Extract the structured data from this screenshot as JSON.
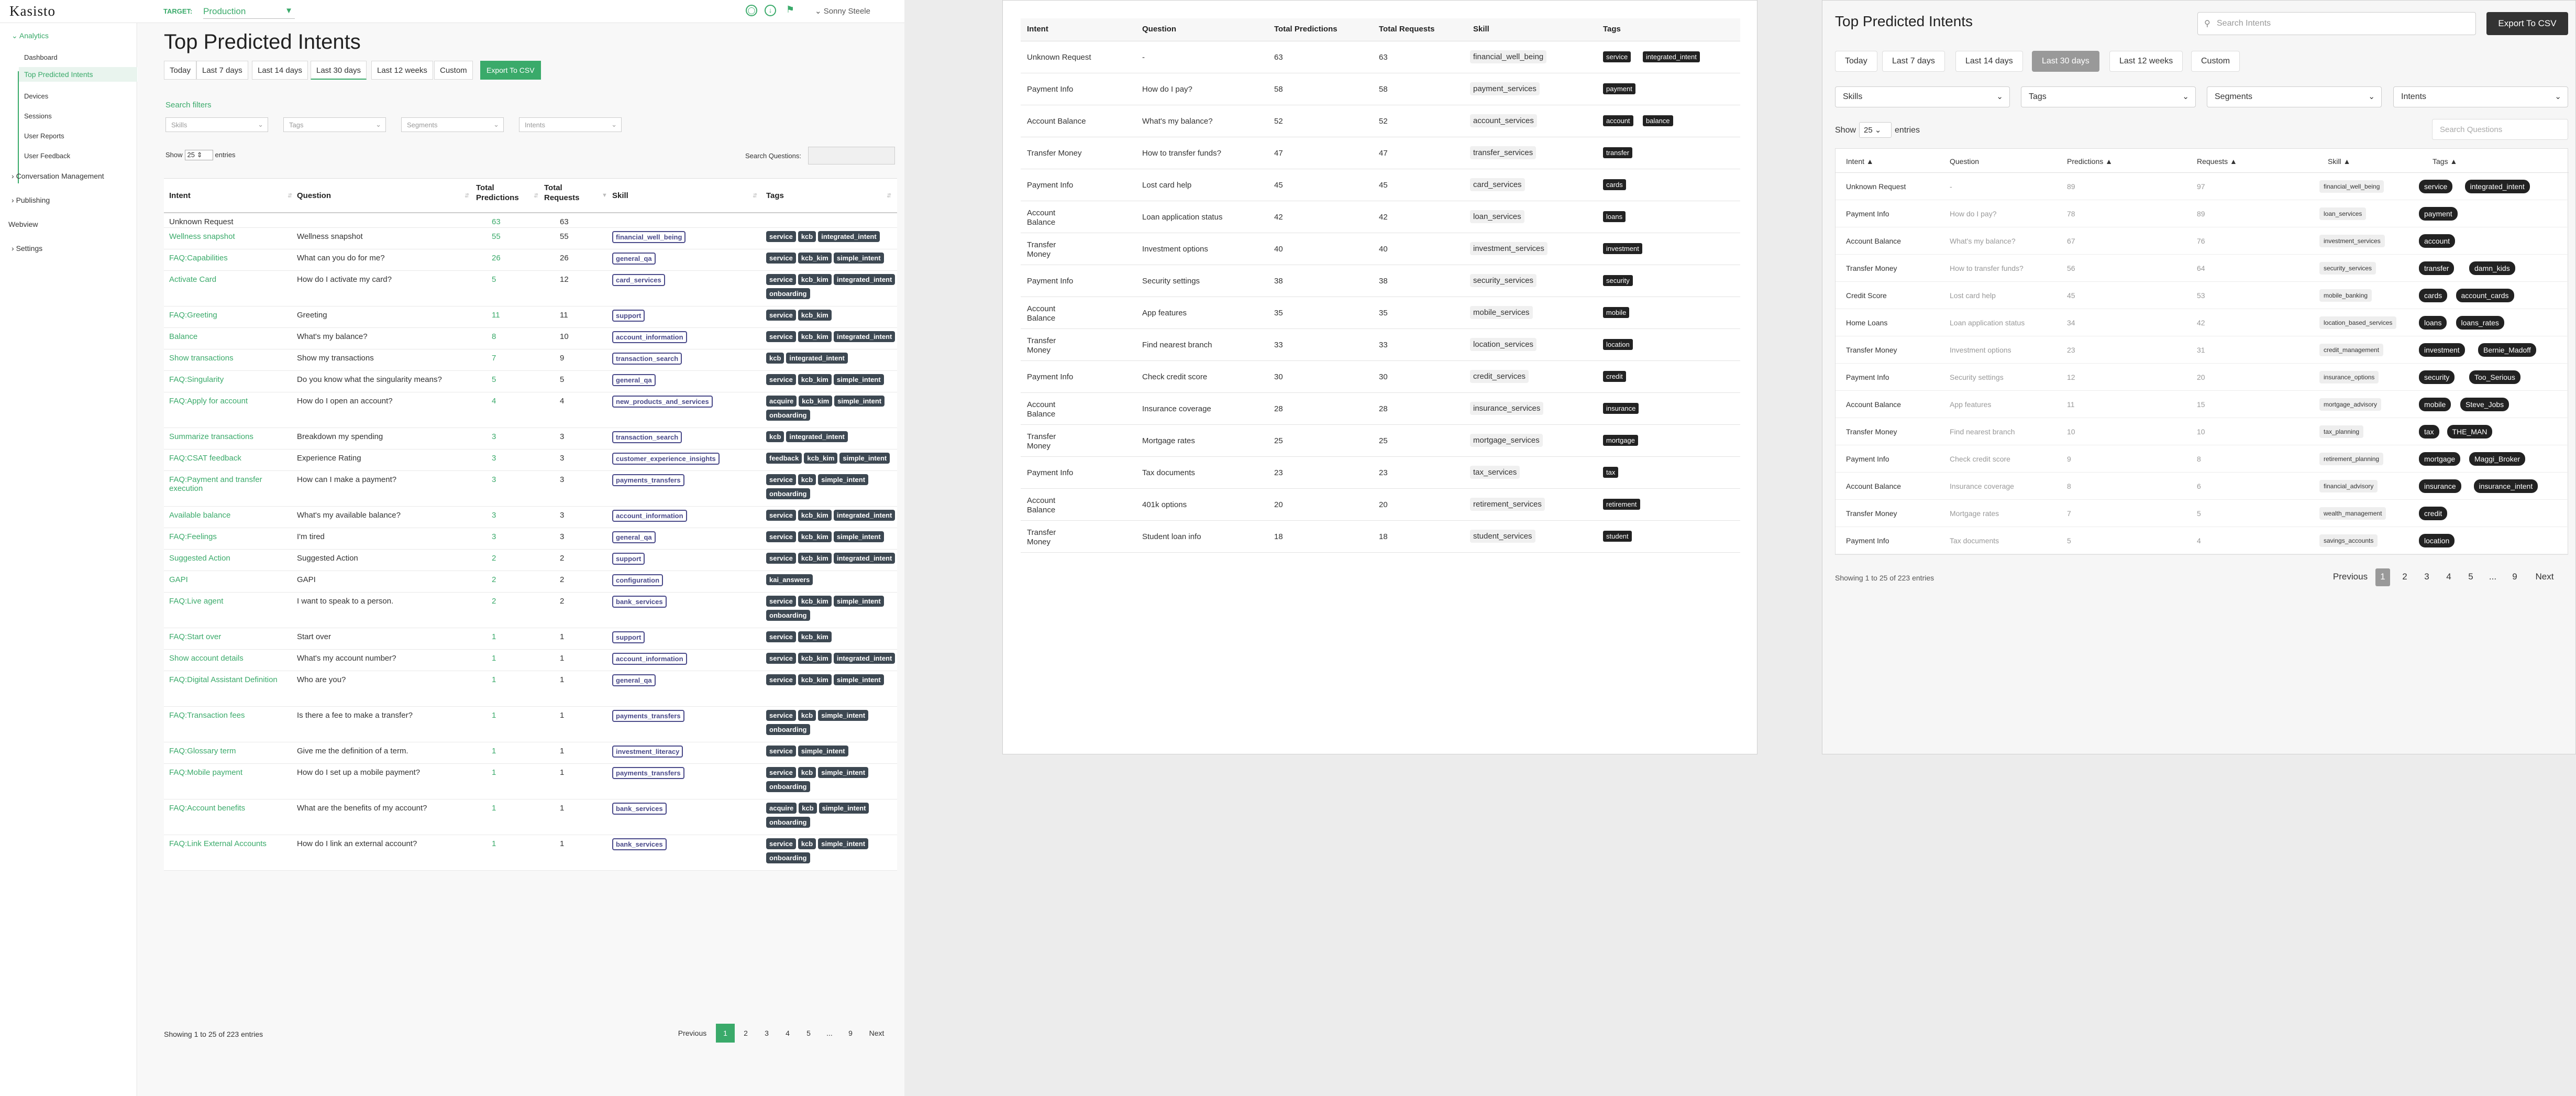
{
  "panelA": {
    "logo": "Kasisto",
    "target_label": "TARGET:",
    "environment": "Production",
    "user": "Sonny Steele",
    "nav": {
      "analytics": "Analytics",
      "items": [
        "Dashboard",
        "Top Predicted Intents",
        "Devices",
        "Sessions",
        "User Reports",
        "User Feedback"
      ],
      "conversation": "Conversation Management",
      "publishing": "Publishing",
      "webview": "Webview",
      "settings": "Settings"
    },
    "title": "Top Predicted Intents",
    "date_buttons": [
      "Today",
      "Last 7 days",
      "Last 14 days",
      "Last 30 days",
      "Last 12 weeks",
      "Custom"
    ],
    "export": "Export To CSV",
    "search_filters": "Search filters",
    "filters": [
      "Skills",
      "Tags",
      "Segments",
      "Intents"
    ],
    "show": "Show",
    "page_size": "25",
    "entries": "entries",
    "search_questions": "Search Questions:",
    "headers": {
      "intent": "Intent",
      "question": "Question",
      "predictions": "Total Predictions",
      "requests": "Total Requests",
      "skill": "Skill",
      "tags": "Tags"
    },
    "rows": [
      {
        "intent": "Unknown Request",
        "question": "",
        "pred": "63",
        "req": "63",
        "skill": "",
        "tags": []
      },
      {
        "intent": "Wellness snapshot",
        "question": "Wellness snapshot",
        "pred": "55",
        "req": "55",
        "skill": "financial_well_being",
        "tags": [
          "service",
          "kcb",
          "integrated_intent"
        ]
      },
      {
        "intent": "FAQ:Capabilities",
        "question": "What can you do for me?",
        "pred": "26",
        "req": "26",
        "skill": "general_qa",
        "tags": [
          "service",
          "kcb_kim",
          "simple_intent"
        ]
      },
      {
        "intent": "Activate Card",
        "question": "How do I activate my card?",
        "pred": "5",
        "req": "12",
        "skill": "card_services",
        "tags": [
          "service",
          "kcb_kim",
          "integrated_intent",
          "onboarding"
        ]
      },
      {
        "intent": "FAQ:Greeting",
        "question": "Greeting",
        "pred": "11",
        "req": "11",
        "skill": "support",
        "tags": [
          "service",
          "kcb_kim"
        ]
      },
      {
        "intent": "Balance",
        "question": "What's my balance?",
        "pred": "8",
        "req": "10",
        "skill": "account_information",
        "tags": [
          "service",
          "kcb_kim",
          "integrated_intent"
        ]
      },
      {
        "intent": "Show transactions",
        "question": "Show my transactions",
        "pred": "7",
        "req": "9",
        "skill": "transaction_search",
        "tags": [
          "kcb",
          "integrated_intent"
        ]
      },
      {
        "intent": "FAQ:Singularity",
        "question": "Do you know what the singularity means?",
        "pred": "5",
        "req": "5",
        "skill": "general_qa",
        "tags": [
          "service",
          "kcb_kim",
          "simple_intent"
        ]
      },
      {
        "intent": "FAQ:Apply for account",
        "question": "How do I open an account?",
        "pred": "4",
        "req": "4",
        "skill": "new_products_and_services",
        "tags": [
          "acquire",
          "kcb_kim",
          "simple_intent",
          "onboarding"
        ]
      },
      {
        "intent": "Summarize transactions",
        "question": "Breakdown my spending",
        "pred": "3",
        "req": "3",
        "skill": "transaction_search",
        "tags": [
          "kcb",
          "integrated_intent"
        ]
      },
      {
        "intent": "FAQ:CSAT feedback",
        "question": "Experience Rating",
        "pred": "3",
        "req": "3",
        "skill": "customer_experience_insights",
        "tags": [
          "feedback",
          "kcb_kim",
          "simple_intent"
        ]
      },
      {
        "intent": "FAQ:Payment and transfer execution",
        "question": "How can I make a payment?",
        "pred": "3",
        "req": "3",
        "skill": "payments_transfers",
        "tags": [
          "service",
          "kcb",
          "simple_intent",
          "onboarding"
        ]
      },
      {
        "intent": "Available balance",
        "question": "What's my available balance?",
        "pred": "3",
        "req": "3",
        "skill": "account_information",
        "tags": [
          "service",
          "kcb_kim",
          "integrated_intent"
        ]
      },
      {
        "intent": "FAQ:Feelings",
        "question": "I'm tired",
        "pred": "3",
        "req": "3",
        "skill": "general_qa",
        "tags": [
          "service",
          "kcb_kim",
          "simple_intent"
        ]
      },
      {
        "intent": "Suggested Action",
        "question": "Suggested Action",
        "pred": "2",
        "req": "2",
        "skill": "support",
        "tags": [
          "service",
          "kcb_kim",
          "integrated_intent"
        ]
      },
      {
        "intent": "GAPI",
        "question": "GAPI",
        "pred": "2",
        "req": "2",
        "skill": "configuration",
        "tags": [
          "kai_answers"
        ]
      },
      {
        "intent": "FAQ:Live agent",
        "question": "I want to speak to a person.",
        "pred": "2",
        "req": "2",
        "skill": "bank_services",
        "tags": [
          "service",
          "kcb_kim",
          "simple_intent",
          "onboarding"
        ]
      },
      {
        "intent": "FAQ:Start over",
        "question": "Start over",
        "pred": "1",
        "req": "1",
        "skill": "support",
        "tags": [
          "service",
          "kcb_kim"
        ]
      },
      {
        "intent": "Show account details",
        "question": "What's my account number?",
        "pred": "1",
        "req": "1",
        "skill": "account_information",
        "tags": [
          "service",
          "kcb_kim",
          "integrated_intent"
        ]
      },
      {
        "intent": "FAQ:Digital Assistant Definition",
        "question": "Who are you?",
        "pred": "1",
        "req": "1",
        "skill": "general_qa",
        "tags": [
          "service",
          "kcb_kim",
          "simple_intent"
        ]
      },
      {
        "intent": "FAQ:Transaction fees",
        "question": "Is there a fee to make a transfer?",
        "pred": "1",
        "req": "1",
        "skill": "payments_transfers",
        "tags": [
          "service",
          "kcb",
          "simple_intent",
          "onboarding"
        ]
      },
      {
        "intent": "FAQ:Glossary term",
        "question": "Give me the definition of a term.",
        "pred": "1",
        "req": "1",
        "skill": "investment_literacy",
        "tags": [
          "service",
          "simple_intent"
        ]
      },
      {
        "intent": "FAQ:Mobile payment",
        "question": "How do I set up a mobile payment?",
        "pred": "1",
        "req": "1",
        "skill": "payments_transfers",
        "tags": [
          "service",
          "kcb",
          "simple_intent",
          "onboarding"
        ]
      },
      {
        "intent": "FAQ:Account benefits",
        "question": "What are the benefits of my account?",
        "pred": "1",
        "req": "1",
        "skill": "bank_services",
        "tags": [
          "acquire",
          "kcb",
          "simple_intent",
          "onboarding"
        ]
      },
      {
        "intent": "FAQ:Link External Accounts",
        "question": "How do I link an external account?",
        "pred": "1",
        "req": "1",
        "skill": "bank_services",
        "tags": [
          "service",
          "kcb",
          "simple_intent",
          "onboarding"
        ]
      }
    ],
    "footer": "Showing 1 to 25 of 223 entries",
    "pager": [
      "Previous",
      "1",
      "2",
      "3",
      "4",
      "5",
      "...",
      "9",
      "Next"
    ]
  },
  "panelB": {
    "headers": {
      "intent": "Intent",
      "question": "Question",
      "predictions": "Total Predictions",
      "requests": "Total Requests",
      "skill": "Skill",
      "tags": "Tags"
    },
    "rows": [
      {
        "intent": "Unknown Request",
        "question": "-",
        "pred": "63",
        "req": "63",
        "skill": "financial_well_being",
        "tags": [
          "service",
          "integrated_intent"
        ]
      },
      {
        "intent": "Payment Info",
        "question": "How do I pay?",
        "pred": "58",
        "req": "58",
        "skill": "payment_services",
        "tags": [
          "payment"
        ]
      },
      {
        "intent": "Account Balance",
        "question": "What's my balance?",
        "pred": "52",
        "req": "52",
        "skill": "account_services",
        "tags": [
          "account",
          "balance"
        ]
      },
      {
        "intent": "Transfer Money",
        "question": "How to transfer funds?",
        "pred": "47",
        "req": "47",
        "skill": "transfer_services",
        "tags": [
          "transfer"
        ]
      },
      {
        "intent": "Payment Info",
        "question": "Lost card help",
        "pred": "45",
        "req": "45",
        "skill": "card_services",
        "tags": [
          "cards"
        ]
      },
      {
        "intent": "Account Balance",
        "question": "Loan application status",
        "pred": "42",
        "req": "42",
        "skill": "loan_services",
        "tags": [
          "loans"
        ]
      },
      {
        "intent": "Transfer Money",
        "question": "Investment options",
        "pred": "40",
        "req": "40",
        "skill": "investment_services",
        "tags": [
          "investment"
        ]
      },
      {
        "intent": "Payment Info",
        "question": "Security settings",
        "pred": "38",
        "req": "38",
        "skill": "security_services",
        "tags": [
          "security"
        ]
      },
      {
        "intent": "Account Balance",
        "question": "App features",
        "pred": "35",
        "req": "35",
        "skill": "mobile_services",
        "tags": [
          "mobile"
        ]
      },
      {
        "intent": "Transfer Money",
        "question": "Find nearest branch",
        "pred": "33",
        "req": "33",
        "skill": "location_services",
        "tags": [
          "location"
        ]
      },
      {
        "intent": "Payment Info",
        "question": "Check credit score",
        "pred": "30",
        "req": "30",
        "skill": "credit_services",
        "tags": [
          "credit"
        ]
      },
      {
        "intent": "Account Balance",
        "question": "Insurance coverage",
        "pred": "28",
        "req": "28",
        "skill": "insurance_services",
        "tags": [
          "insurance"
        ]
      },
      {
        "intent": "Transfer Money",
        "question": "Mortgage rates",
        "pred": "25",
        "req": "25",
        "skill": "mortgage_services",
        "tags": [
          "mortgage"
        ]
      },
      {
        "intent": "Payment Info",
        "question": "Tax documents",
        "pred": "23",
        "req": "23",
        "skill": "tax_services",
        "tags": [
          "tax"
        ]
      },
      {
        "intent": "Account Balance",
        "question": "401k options",
        "pred": "20",
        "req": "20",
        "skill": "retirement_services",
        "tags": [
          "retirement"
        ]
      },
      {
        "intent": "Transfer Money",
        "question": "Student loan info",
        "pred": "18",
        "req": "18",
        "skill": "student_services",
        "tags": [
          "student"
        ]
      }
    ]
  },
  "panelC": {
    "title": "Top Predicted Intents",
    "search_placeholder": "Search Intents",
    "export": "Export To CSV",
    "date_buttons": [
      "Today",
      "Last 7 days",
      "Last 14 days",
      "Last 30 days",
      "Last 12 weeks",
      "Custom"
    ],
    "filters": [
      "Skills",
      "Tags",
      "Segments",
      "Intents"
    ],
    "show": "Show",
    "page_size": "25",
    "entries": "entries",
    "search_questions": "Search Questions",
    "headers": {
      "intent": "Intent",
      "question": "Question",
      "predictions": "Predictions",
      "requests": "Requests",
      "skill": "Skill",
      "tags": "Tags"
    },
    "rows": [
      {
        "intent": "Unknown Request",
        "question": "-",
        "pred": "89",
        "req": "97",
        "skill": "financial_well_being",
        "tags": [
          "service",
          "integrated_intent"
        ]
      },
      {
        "intent": "Payment Info",
        "question": "How do I pay?",
        "pred": "78",
        "req": "89",
        "skill": "loan_services",
        "tags": [
          "payment"
        ]
      },
      {
        "intent": "Account Balance",
        "question": "What's my balance?",
        "pred": "67",
        "req": "76",
        "skill": "investment_services",
        "tags": [
          "account"
        ]
      },
      {
        "intent": "Transfer Money",
        "question": "How to transfer funds?",
        "pred": "56",
        "req": "64",
        "skill": "security_services",
        "tags": [
          "transfer",
          "damn_kids"
        ]
      },
      {
        "intent": "Credit Score",
        "question": "Lost card help",
        "pred": "45",
        "req": "53",
        "skill": "mobile_banking",
        "tags": [
          "cards",
          "account_cards"
        ]
      },
      {
        "intent": "Home Loans",
        "question": "Loan application status",
        "pred": "34",
        "req": "42",
        "skill": "location_based_services",
        "tags": [
          "loans",
          "loans_rates"
        ]
      },
      {
        "intent": "Transfer Money",
        "question": "Investment options",
        "pred": "23",
        "req": "31",
        "skill": "credit_management",
        "tags": [
          "investment",
          "Bernie_Madoff"
        ]
      },
      {
        "intent": "Payment Info",
        "question": "Security settings",
        "pred": "12",
        "req": "20",
        "skill": "insurance_options",
        "tags": [
          "security",
          "Too_Serious"
        ]
      },
      {
        "intent": "Account Balance",
        "question": "App features",
        "pred": "11",
        "req": "15",
        "skill": "mortgage_advisory",
        "tags": [
          "mobile",
          "Steve_Jobs"
        ]
      },
      {
        "intent": "Transfer Money",
        "question": "Find nearest branch",
        "pred": "10",
        "req": "10",
        "skill": "tax_planning",
        "tags": [
          "tax",
          "THE_MAN"
        ]
      },
      {
        "intent": "Payment Info",
        "question": "Check credit score",
        "pred": "9",
        "req": "8",
        "skill": "retirement_planning",
        "tags": [
          "mortgage",
          "Maggi_Broker"
        ]
      },
      {
        "intent": "Account Balance",
        "question": "Insurance coverage",
        "pred": "8",
        "req": "6",
        "skill": "financial_advisory",
        "tags": [
          "insurance",
          "insurance_intent"
        ]
      },
      {
        "intent": "Transfer Money",
        "question": "Mortgage rates",
        "pred": "7",
        "req": "5",
        "skill": "wealth_management",
        "tags": [
          "credit"
        ]
      },
      {
        "intent": "Payment Info",
        "question": "Tax documents",
        "pred": "5",
        "req": "4",
        "skill": "savings_accounts",
        "tags": [
          "location"
        ]
      }
    ],
    "footer": "Showing 1 to 25 of 223 entries",
    "pager": [
      "Previous",
      "1",
      "2",
      "3",
      "4",
      "5",
      "...",
      "9",
      "Next"
    ]
  }
}
